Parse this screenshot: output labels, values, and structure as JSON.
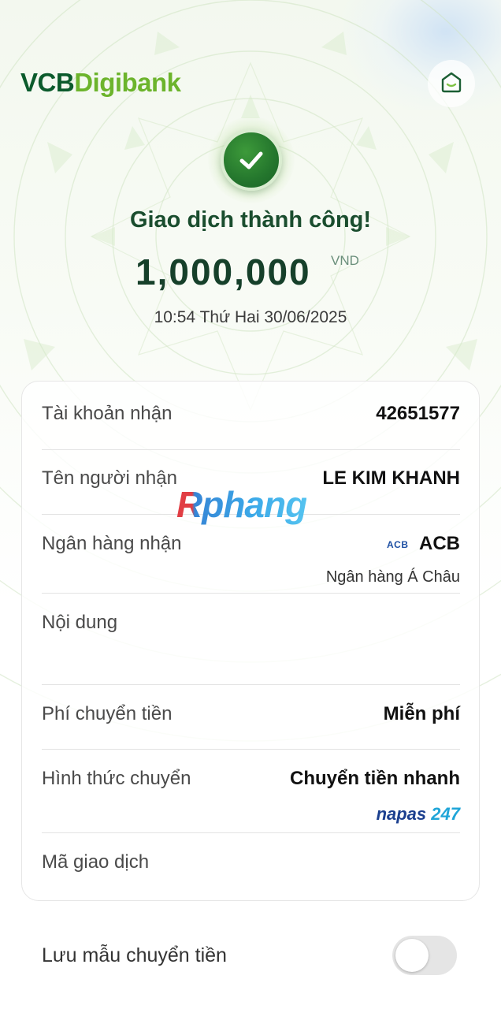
{
  "brand": {
    "part1": "VCB",
    "part2": "Digibank"
  },
  "icons": {
    "home": "home-icon",
    "success": "checkmark-icon"
  },
  "colors": {
    "brand_dark": "#0b5b2c",
    "brand_light": "#6cb42c",
    "title": "#1a4d2e"
  },
  "transaction": {
    "status": "Giao dịch thành công!",
    "amount": "1,000,000",
    "currency": "VND",
    "datetime": "10:54 Thứ Hai 30/06/2025"
  },
  "details": {
    "account": {
      "label": "Tài khoản nhận",
      "value": "42651577"
    },
    "recipient": {
      "label": "Tên người nhận",
      "value": "LE KIM KHANH"
    },
    "bank": {
      "label": "Ngân hàng nhận",
      "logo_text": "ACB",
      "value": "ACB",
      "full_name": "Ngân hàng Á Châu"
    },
    "content": {
      "label": "Nội dung",
      "value": ""
    },
    "fee": {
      "label": "Phí chuyển tiền",
      "value": "Miễn phí"
    },
    "method": {
      "label": "Hình thức chuyển",
      "value": "Chuyển tiền nhanh",
      "network_part1": "napas",
      "network_part2": "247"
    },
    "txn_id": {
      "label": "Mã giao dịch",
      "value": ""
    }
  },
  "watermark": "Rphang",
  "save_template": {
    "label": "Lưu mẫu chuyển tiền",
    "enabled": false
  }
}
